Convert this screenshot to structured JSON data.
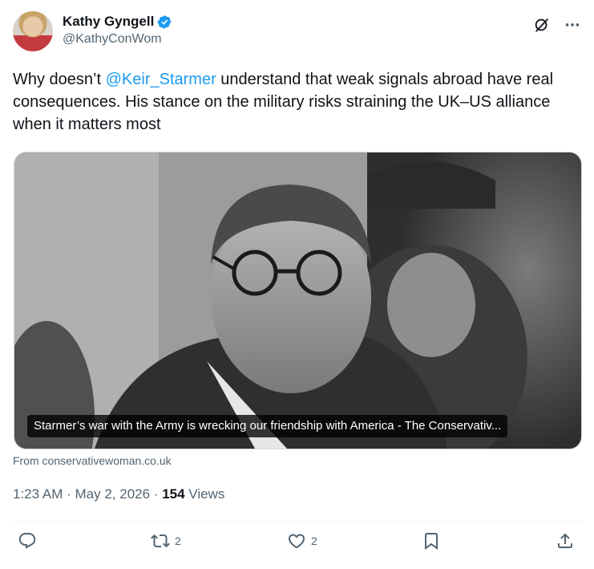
{
  "author": {
    "name": "Kathy Gyngell",
    "handle": "@KathyConWom",
    "verified": true
  },
  "tweet": {
    "text_before": "Why doesn’t ",
    "mention": "@Keir_Starmer",
    "text_after": " understand that weak signals abroad have real consequences. His stance on the military risks straining the UK–US alliance when it matters most"
  },
  "card": {
    "caption": "Starmer’s war with the Army is wrecking our friendship with America - The Conservativ...",
    "source": "From conservativewoman.co.uk"
  },
  "meta": {
    "time": "1:23 AM",
    "date": "May 2, 2026",
    "views_count": "154",
    "views_label": "Views"
  },
  "actions": {
    "reposts": "2",
    "likes": "2"
  },
  "colors": {
    "accent": "#1d9bf0",
    "secondary_text": "#536471"
  },
  "icons": [
    "verified-badge-icon",
    "grok-icon",
    "more-icon",
    "reply-icon",
    "repost-icon",
    "like-icon",
    "bookmark-icon",
    "share-icon"
  ]
}
